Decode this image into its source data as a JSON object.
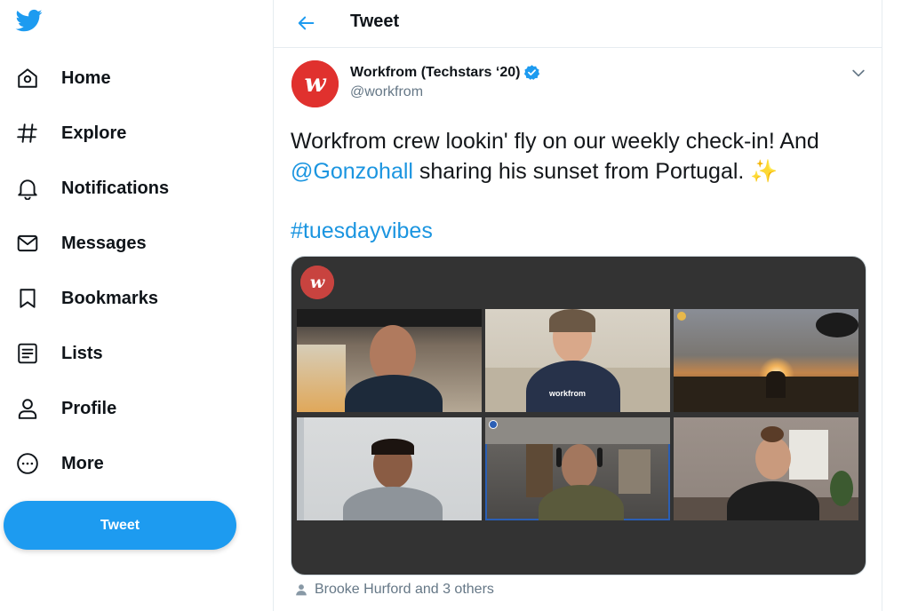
{
  "sidebar": {
    "logo": "twitter-bird-icon",
    "items": [
      {
        "label": "Home",
        "icon": "home-icon"
      },
      {
        "label": "Explore",
        "icon": "hashtag-icon"
      },
      {
        "label": "Notifications",
        "icon": "bell-icon"
      },
      {
        "label": "Messages",
        "icon": "envelope-icon"
      },
      {
        "label": "Bookmarks",
        "icon": "bookmark-icon"
      },
      {
        "label": "Lists",
        "icon": "list-icon"
      },
      {
        "label": "Profile",
        "icon": "person-icon"
      },
      {
        "label": "More",
        "icon": "more-circle-icon"
      }
    ],
    "tweet_button": "Tweet"
  },
  "header": {
    "title": "Tweet",
    "back_icon": "back-arrow-icon"
  },
  "tweet": {
    "author": {
      "display_name": "Workfrom (Techstars ‘20)",
      "handle": "@workfrom",
      "verified": true,
      "avatar_text": "w"
    },
    "text_part1": "Workfrom crew lookin' fly on our weekly check-in! And",
    "mention": "@Gonzohall",
    "text_part2": " sharing his sunset from Portugal. ",
    "emoji": "✨",
    "hashtag": "#tuesdayvibes",
    "media_logo_text": "w",
    "shirt_text": "workfrom",
    "tagged": "Brooke Hurford and 3 others"
  },
  "colors": {
    "accent": "#1d9bf0",
    "link": "#1b95e0",
    "brand_red": "#e0312e",
    "media_bg": "#333333"
  }
}
